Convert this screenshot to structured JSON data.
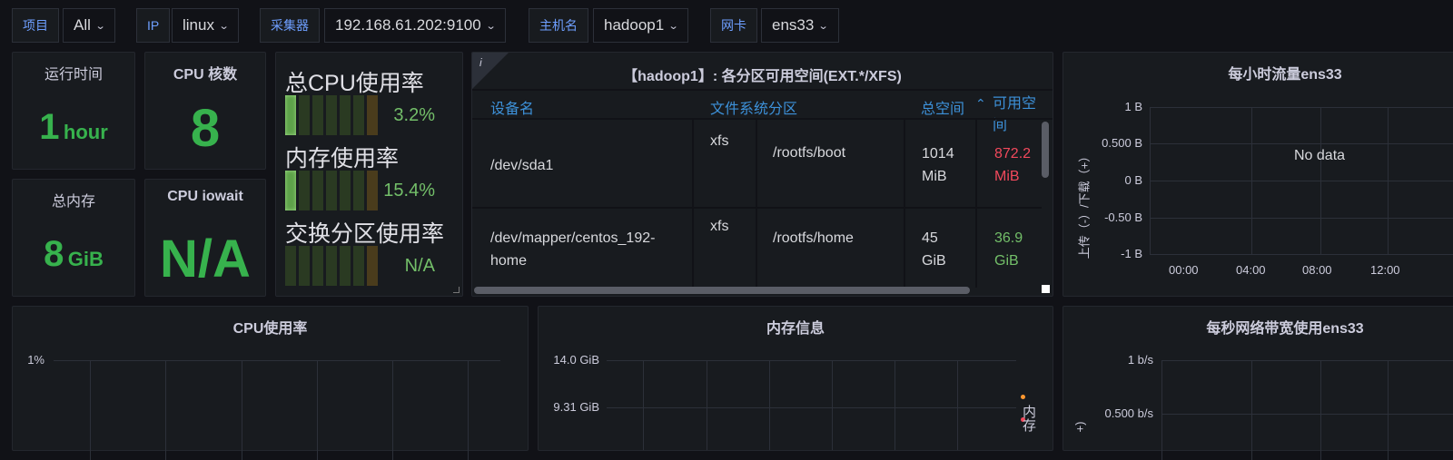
{
  "variables": [
    {
      "label": "项目",
      "value": "All"
    },
    {
      "label": "IP",
      "value": "linux"
    },
    {
      "label": "采集器",
      "value": "192.168.61.202:9100"
    },
    {
      "label": "主机名",
      "value": "hadoop1"
    },
    {
      "label": "网卡",
      "value": "ens33"
    }
  ],
  "stats": {
    "uptime": {
      "title": "运行时间",
      "value": "1",
      "unit": "hour"
    },
    "cpu_cores": {
      "title": "CPU 核数",
      "value": "8"
    },
    "total_mem": {
      "title": "总内存",
      "value": "8",
      "unit": "GiB"
    },
    "cpu_iowait": {
      "title": "CPU iowait",
      "value": "N/A"
    }
  },
  "gauges": [
    {
      "label": "总CPU使用率",
      "value": "3.2%",
      "fraction": 0.032
    },
    {
      "label": "内存使用率",
      "value": "15.4%",
      "fraction": 0.154
    },
    {
      "label": "交换分区使用率",
      "value": "N/A",
      "fraction": 0
    }
  ],
  "table": {
    "info_icon": "i",
    "title": "【hadoop1】: 各分区可用空间(EXT.*/XFS)",
    "headers": [
      "设备名",
      "文件系统分区",
      "总空间",
      "可用空间"
    ],
    "rows": [
      {
        "device": "/dev/sda1",
        "fs": "xfs",
        "mount": "/rootfs/boot",
        "total": "1014 MiB",
        "avail": "872.2 MiB",
        "avail_color": "#f2495c"
      },
      {
        "device": "/dev/mapper/centos_192-home",
        "fs": "xfs",
        "mount": "/rootfs/home",
        "total": "45 GiB",
        "avail": "36.9 GiB",
        "avail_color": "#73bf69"
      }
    ]
  },
  "traffic": {
    "title": "每小时流量ens33",
    "no_data": "No data",
    "ylabel": "上传（-）/下载（+）",
    "yticks": [
      "1 B",
      "0.500 B",
      "0 B",
      "-0.50 B",
      "-1 B"
    ],
    "xticks": [
      "00:00",
      "04:00",
      "08:00",
      "12:00"
    ]
  },
  "cpu_usage": {
    "title": "CPU使用率",
    "yticks": [
      "1%"
    ]
  },
  "mem_info": {
    "title": "内存信息",
    "yticks": [
      "14.0 GiB",
      "9.31 GiB"
    ],
    "legend_partial": "内存"
  },
  "bandwidth": {
    "title": "每秒网络带宽使用ens33",
    "yticks": [
      "1 b/s",
      "0.500 b/s"
    ],
    "ylabel_partial": "+)"
  }
}
